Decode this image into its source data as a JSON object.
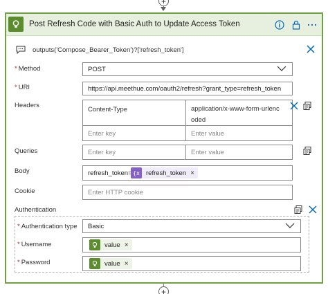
{
  "card": {
    "title": "Post Refresh Code with Basic Auth to Update Access Token"
  },
  "comment": {
    "expression": "outputs('Compose_Bearer_Token')?['refresh_token']"
  },
  "fields": {
    "method": {
      "label": "Method",
      "value": "POST"
    },
    "uri": {
      "label": "URI",
      "value": "https://api.meethue.com/oauth2/refresh?grant_type=refresh_token"
    },
    "headers": {
      "label": "Headers",
      "key": "Content-Type",
      "value_line1": "application/x-www-form-urlenc",
      "value_line2": "oded",
      "key_placeholder": "Enter key",
      "value_placeholder": "Enter value"
    },
    "queries": {
      "label": "Queries",
      "key_placeholder": "Enter key",
      "value_placeholder": "Enter value"
    },
    "body": {
      "label": "Body",
      "prefix": "refresh_token=",
      "token": "refresh_token",
      "token_x": "×"
    },
    "cookie": {
      "label": "Cookie",
      "placeholder": "Enter HTTP cookie"
    },
    "authentication": {
      "label": "Authentication",
      "type_label": "Authentication type",
      "type_value": "Basic",
      "username_label": "Username",
      "username_token": "value",
      "password_label": "Password",
      "password_token": "value",
      "token_x": "×"
    }
  },
  "colors": {
    "accent_green": "#5b8d2f",
    "header_bg": "#e7f0de",
    "link_blue": "#0067b8",
    "expression_purple": "#8661c5"
  }
}
